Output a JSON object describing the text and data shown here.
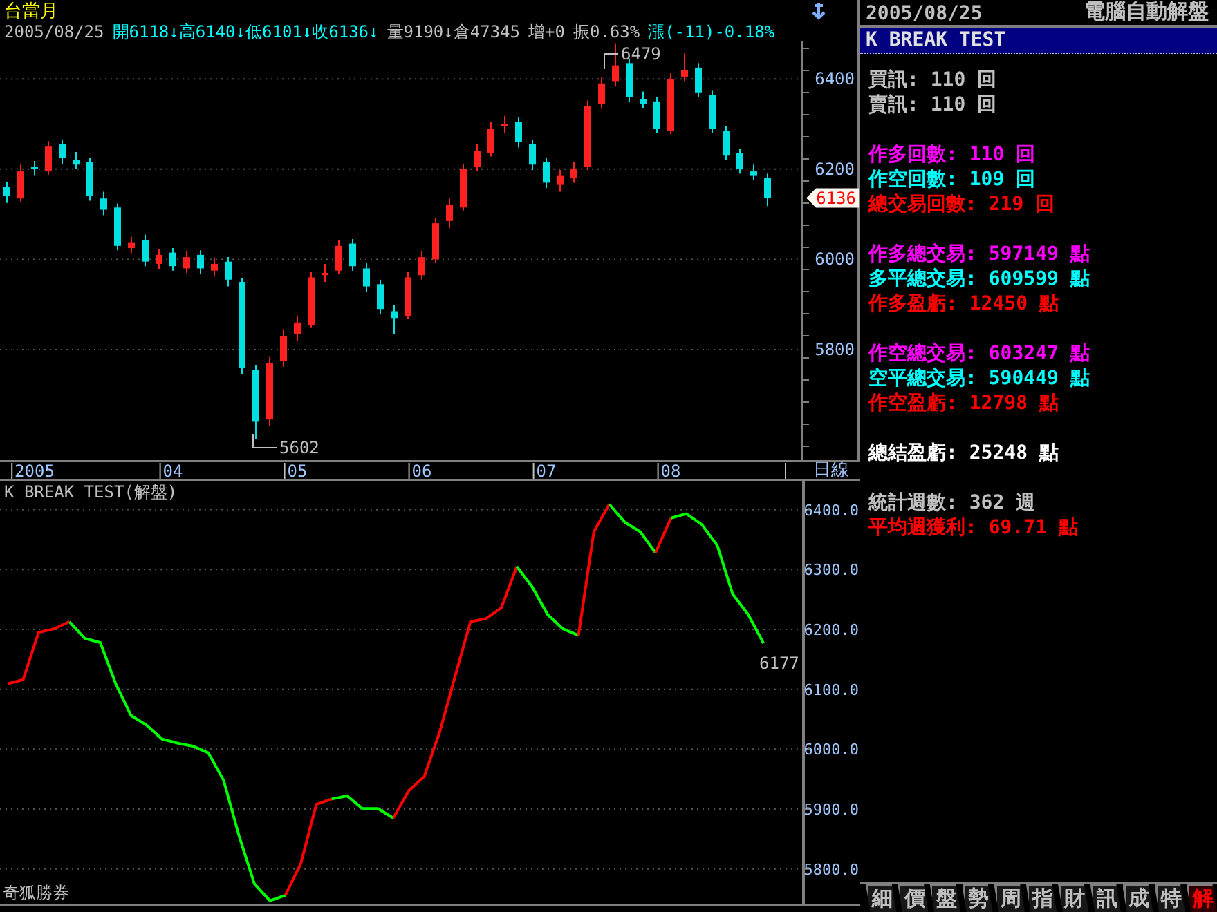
{
  "quote_header": {
    "contract": "台當月",
    "items": [
      {
        "text": "2005/08/25",
        "color": "#c0c0c0"
      },
      {
        "text": "開6118↓高6140↓低6101↓收6136↓",
        "color": "#00ffff"
      },
      {
        "text": "量9190↓倉47345",
        "color": "#c0c0c0"
      },
      {
        "text": "增+0",
        "color": "#c0c0c0"
      },
      {
        "text": "振0.63%",
        "color": "#c0c0c0"
      },
      {
        "text": "漲(-11)-0.18%",
        "color": "#00ffff"
      }
    ]
  },
  "price_chart": {
    "high_label": "6479",
    "low_label": "5602",
    "last_price_tag": "6136",
    "period_button": "日線",
    "chart_data": {
      "type": "candlestick",
      "categories": [
        null,
        null,
        "2005",
        null,
        null,
        null,
        null,
        null,
        null,
        null,
        null,
        null,
        "04",
        null,
        null,
        null,
        null,
        null,
        null,
        null,
        null,
        "05",
        null,
        null,
        null,
        null,
        null,
        null,
        null,
        null,
        "06",
        null,
        null,
        null,
        null,
        null,
        null,
        null,
        null,
        "07",
        null,
        null,
        null,
        null,
        null,
        null,
        null,
        null,
        "08",
        null,
        null,
        null,
        null,
        null,
        null,
        null,
        null,
        null
      ],
      "ylim": [
        5509,
        6483
      ],
      "grid": true,
      "yticks": [
        6400,
        6200,
        6000,
        5800
      ],
      "ohlc": [
        [
          6160,
          6172,
          6125,
          6140
        ],
        [
          6135,
          6210,
          6128,
          6195
        ],
        [
          6205,
          6218,
          6185,
          6200
        ],
        [
          6195,
          6262,
          6188,
          6250
        ],
        [
          6255,
          6266,
          6212,
          6225
        ],
        [
          6220,
          6238,
          6200,
          6210
        ],
        [
          6215,
          6224,
          6130,
          6140
        ],
        [
          6135,
          6150,
          6098,
          6110
        ],
        [
          6115,
          6124,
          6020,
          6030
        ],
        [
          6025,
          6050,
          6014,
          6038
        ],
        [
          6042,
          6055,
          5985,
          5995
        ],
        [
          5990,
          6022,
          5978,
          6010
        ],
        [
          6015,
          6025,
          5975,
          5985
        ],
        [
          5980,
          6018,
          5970,
          6005
        ],
        [
          6010,
          6020,
          5968,
          5980
        ],
        [
          5975,
          6002,
          5962,
          5990
        ],
        [
          5995,
          6005,
          5940,
          5955
        ],
        [
          5950,
          5958,
          5745,
          5760
        ],
        [
          5755,
          5765,
          5602,
          5640
        ],
        [
          5645,
          5785,
          5630,
          5770
        ],
        [
          5775,
          5845,
          5762,
          5830
        ],
        [
          5835,
          5875,
          5820,
          5860
        ],
        [
          5855,
          5972,
          5848,
          5960
        ],
        [
          5965,
          5990,
          5950,
          5970
        ],
        [
          5975,
          6042,
          5968,
          6030
        ],
        [
          6035,
          6045,
          5975,
          5985
        ],
        [
          5980,
          5992,
          5928,
          5940
        ],
        [
          5945,
          5955,
          5878,
          5890
        ],
        [
          5885,
          5898,
          5835,
          5870
        ],
        [
          5875,
          5972,
          5868,
          5960
        ],
        [
          5965,
          6018,
          5955,
          6005
        ],
        [
          6000,
          6092,
          5992,
          6080
        ],
        [
          6085,
          6135,
          6070,
          6120
        ],
        [
          6115,
          6212,
          6108,
          6200
        ],
        [
          6205,
          6255,
          6195,
          6240
        ],
        [
          6235,
          6305,
          6228,
          6290
        ],
        [
          6295,
          6318,
          6280,
          6300
        ],
        [
          6305,
          6315,
          6248,
          6260
        ],
        [
          6255,
          6265,
          6198,
          6210
        ],
        [
          6215,
          6225,
          6158,
          6170
        ],
        [
          6165,
          6198,
          6150,
          6185
        ],
        [
          6180,
          6215,
          6170,
          6200
        ],
        [
          6205,
          6352,
          6198,
          6340
        ],
        [
          6345,
          6405,
          6335,
          6390
        ],
        [
          6395,
          6479,
          6385,
          6430
        ],
        [
          6435,
          6445,
          6348,
          6360
        ],
        [
          6355,
          6372,
          6335,
          6345
        ],
        [
          6350,
          6360,
          6280,
          6290
        ],
        [
          6285,
          6412,
          6278,
          6400
        ],
        [
          6405,
          6458,
          6395,
          6420
        ],
        [
          6425,
          6435,
          6360,
          6370
        ],
        [
          6365,
          6375,
          6280,
          6290
        ],
        [
          6285,
          6295,
          6220,
          6230
        ],
        [
          6235,
          6245,
          6190,
          6200
        ],
        [
          6195,
          6210,
          6175,
          6185
        ],
        [
          6180,
          6190,
          6118,
          6136
        ],
        null,
        null
      ]
    }
  },
  "indicator_chart": {
    "title": "K BREAK TEST(解盤)",
    "last_value_label": "6177",
    "chart_data": {
      "type": "line",
      "grid": true,
      "categories": [
        null,
        null,
        null,
        null,
        null,
        null,
        null,
        null,
        null,
        null,
        null,
        null,
        null,
        null,
        null,
        null,
        null,
        null,
        null,
        null,
        null,
        null,
        null,
        null,
        null,
        null,
        null,
        null,
        null,
        null,
        null,
        null,
        null,
        null,
        null,
        null,
        null,
        null,
        null,
        null,
        null,
        null,
        null,
        null,
        null,
        null,
        null,
        null,
        null,
        null,
        null,
        null
      ],
      "ylim": [
        5742,
        6448
      ],
      "yticks": [
        {
          "value": 6400,
          "label": "6400.0"
        },
        {
          "value": 6300,
          "label": "6300.0"
        },
        {
          "value": 6200,
          "label": "6200.0"
        },
        {
          "value": 6100,
          "label": "6100.0"
        },
        {
          "value": 6000,
          "label": "6000.0"
        },
        {
          "value": 5900,
          "label": "5900.0"
        },
        {
          "value": 5800,
          "label": "5800.0"
        }
      ],
      "series": [
        {
          "color": "#ff0000",
          "values": [
            6109,
            6116,
            6195,
            6201,
            6213,
            null,
            null,
            null,
            null,
            null,
            null,
            null,
            null,
            null,
            null,
            null,
            null,
            null,
            null,
            null,
            null,
            null,
            null,
            null,
            null,
            null,
            null,
            null,
            null,
            null,
            null,
            null,
            null,
            null,
            null,
            null,
            null,
            null,
            null,
            null,
            null,
            null,
            null,
            null,
            null,
            null,
            null,
            null,
            null,
            null,
            null,
            null
          ]
        },
        {
          "color": "#00ff00",
          "values": [
            null,
            null,
            null,
            null,
            6213,
            6185,
            6178,
            6109,
            6056,
            6040,
            6017,
            6010,
            6005,
            5994,
            5948,
            5855,
            5775,
            5747,
            5756,
            null,
            null,
            null,
            null,
            null,
            null,
            null,
            null,
            null,
            null,
            null,
            null,
            null,
            null,
            null,
            null,
            null,
            null,
            null,
            null,
            null,
            null,
            null,
            null,
            null,
            null,
            null,
            null,
            null,
            null,
            null,
            null,
            null
          ]
        },
        {
          "color": "#ff0000",
          "values": [
            null,
            null,
            null,
            null,
            null,
            null,
            null,
            null,
            null,
            null,
            null,
            null,
            null,
            null,
            null,
            null,
            null,
            null,
            5756,
            5809,
            5908,
            5917,
            null,
            null,
            null,
            null,
            null,
            null,
            null,
            null,
            null,
            null,
            null,
            null,
            null,
            null,
            null,
            null,
            null,
            null,
            null,
            null,
            null,
            null,
            null,
            null,
            null,
            null,
            null,
            null,
            null,
            null
          ]
        },
        {
          "color": "#00ff00",
          "values": [
            null,
            null,
            null,
            null,
            null,
            null,
            null,
            null,
            null,
            null,
            null,
            null,
            null,
            null,
            null,
            null,
            null,
            null,
            null,
            null,
            null,
            5917,
            5922,
            5901,
            5901,
            5885,
            null,
            null,
            null,
            null,
            null,
            null,
            null,
            null,
            null,
            null,
            null,
            null,
            null,
            null,
            null,
            null,
            null,
            null,
            null,
            null,
            null,
            null,
            null,
            null,
            null,
            null
          ]
        },
        {
          "color": "#ff0000",
          "values": [
            null,
            null,
            null,
            null,
            null,
            null,
            null,
            null,
            null,
            null,
            null,
            null,
            null,
            null,
            null,
            null,
            null,
            null,
            null,
            null,
            null,
            null,
            null,
            null,
            null,
            5885,
            5931,
            5954,
            6028,
            6121,
            6213,
            6218,
            6236,
            6305,
            null,
            null,
            null,
            null,
            null,
            null,
            null,
            null,
            null,
            null,
            null,
            null,
            null,
            null,
            null,
            null,
            null,
            null
          ]
        },
        {
          "color": "#00ff00",
          "values": [
            null,
            null,
            null,
            null,
            null,
            null,
            null,
            null,
            null,
            null,
            null,
            null,
            null,
            null,
            null,
            null,
            null,
            null,
            null,
            null,
            null,
            null,
            null,
            null,
            null,
            null,
            null,
            null,
            null,
            null,
            null,
            null,
            null,
            6305,
            6271,
            6225,
            6201,
            6190,
            null,
            null,
            null,
            null,
            null,
            null,
            null,
            null,
            null,
            null,
            null,
            null,
            null,
            null
          ]
        },
        {
          "color": "#ff0000",
          "values": [
            null,
            null,
            null,
            null,
            null,
            null,
            null,
            null,
            null,
            null,
            null,
            null,
            null,
            null,
            null,
            null,
            null,
            null,
            null,
            null,
            null,
            null,
            null,
            null,
            null,
            null,
            null,
            null,
            null,
            null,
            null,
            null,
            null,
            null,
            null,
            null,
            null,
            6190,
            6363,
            6409,
            null,
            null,
            null,
            null,
            null,
            null,
            null,
            null,
            null,
            null,
            null,
            null
          ]
        },
        {
          "color": "#00ff00",
          "values": [
            null,
            null,
            null,
            null,
            null,
            null,
            null,
            null,
            null,
            null,
            null,
            null,
            null,
            null,
            null,
            null,
            null,
            null,
            null,
            null,
            null,
            null,
            null,
            null,
            null,
            null,
            null,
            null,
            null,
            null,
            null,
            null,
            null,
            null,
            null,
            null,
            null,
            null,
            null,
            6409,
            6379,
            6363,
            6328,
            null,
            null,
            null,
            null,
            null,
            null,
            null,
            null,
            null
          ]
        },
        {
          "color": "#ff0000",
          "values": [
            null,
            null,
            null,
            null,
            null,
            null,
            null,
            null,
            null,
            null,
            null,
            null,
            null,
            null,
            null,
            null,
            null,
            null,
            null,
            null,
            null,
            null,
            null,
            null,
            null,
            null,
            null,
            null,
            null,
            null,
            null,
            null,
            null,
            null,
            null,
            null,
            null,
            null,
            null,
            null,
            null,
            null,
            6328,
            6386,
            null,
            null,
            null,
            null,
            null,
            null,
            null,
            null
          ]
        },
        {
          "color": "#00ff00",
          "values": [
            null,
            null,
            null,
            null,
            null,
            null,
            null,
            null,
            null,
            null,
            null,
            null,
            null,
            null,
            null,
            null,
            null,
            null,
            null,
            null,
            null,
            null,
            null,
            null,
            null,
            null,
            null,
            null,
            null,
            null,
            null,
            null,
            null,
            null,
            null,
            null,
            null,
            null,
            null,
            null,
            null,
            null,
            null,
            6386,
            6393,
            6375,
            6340,
            6259,
            6225,
            6177,
            null,
            null
          ]
        }
      ]
    }
  },
  "footer": {
    "brand": "奇狐勝券"
  },
  "report_panel": {
    "date": "2005/08/25",
    "title": "電腦自動解盤",
    "strategy": "K BREAK TEST",
    "groups": [
      {
        "lines": [
          {
            "text": "買訊: 110 回",
            "color": "#c0c0c0"
          },
          {
            "text": "賣訊: 110 回",
            "color": "#c0c0c0"
          }
        ]
      },
      {
        "lines": [
          {
            "text": "作多回數: 110 回",
            "color": "#ff00ff"
          },
          {
            "text": "作空回數: 109 回",
            "color": "#00ffff"
          },
          {
            "text": "總交易回數: 219 回",
            "color": "#ff0000"
          }
        ]
      },
      {
        "lines": [
          {
            "text": "作多總交易: 597149 點",
            "color": "#ff00ff"
          },
          {
            "text": "多平總交易: 609599 點",
            "color": "#00ffff"
          },
          {
            "text": "作多盈虧: 12450 點",
            "color": "#ff0000"
          }
        ]
      },
      {
        "lines": [
          {
            "text": "作空總交易: 603247 點",
            "color": "#ff00ff"
          },
          {
            "text": "空平總交易: 590449 點",
            "color": "#00ffff"
          },
          {
            "text": "作空盈虧: 12798 點",
            "color": "#ff0000"
          }
        ]
      },
      {
        "lines": [
          {
            "text": "總結盈虧: 25248 點",
            "color": "#ffffff"
          }
        ]
      },
      {
        "lines": [
          {
            "text": "統計週數: 362 週",
            "color": "#c0c0c0"
          },
          {
            "text": "平均週獲利: 69.71 點",
            "color": "#ff0000"
          }
        ]
      }
    ],
    "tabs": [
      {
        "label": "細",
        "selected": false
      },
      {
        "label": "價",
        "selected": false
      },
      {
        "label": "盤",
        "selected": false
      },
      {
        "label": "勢",
        "selected": false
      },
      {
        "label": "周",
        "selected": false
      },
      {
        "label": "指",
        "selected": false
      },
      {
        "label": "財",
        "selected": false
      },
      {
        "label": "訊",
        "selected": false
      },
      {
        "label": "成",
        "selected": false
      },
      {
        "label": "特",
        "selected": false
      },
      {
        "label": "解",
        "selected": true
      }
    ]
  }
}
